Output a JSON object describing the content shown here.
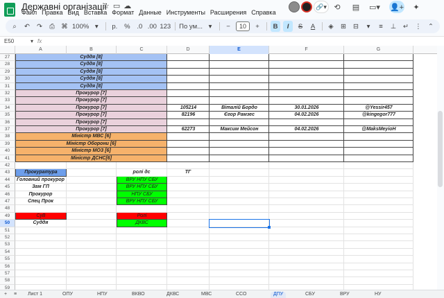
{
  "doc": {
    "title": "Державні організації",
    "menu": [
      "Файл",
      "Правка",
      "Вид",
      "Вставка",
      "Формат",
      "Данные",
      "Инструменты",
      "Расширения",
      "Справка"
    ]
  },
  "toolbar": {
    "zoom": "100%",
    "currency": "р.",
    "percent": "%",
    "dec_less": ".0",
    "dec_more": ".00",
    "number_format": "123",
    "font": "По ум...",
    "font_size": "10",
    "bold": "B",
    "italic": "I",
    "text_color": "A"
  },
  "formula": {
    "cell_ref": "E50",
    "fx": "fx",
    "value": ""
  },
  "columns": [
    "A",
    "B",
    "C",
    "D",
    "E",
    "F",
    "G"
  ],
  "rows": [
    "27",
    "28",
    "29",
    "30",
    "31",
    "32",
    "33",
    "34",
    "35",
    "36",
    "37",
    "38",
    "39",
    "40",
    "41",
    "42",
    "43",
    "44",
    "45",
    "46",
    "47",
    "48",
    "49",
    "50",
    "51",
    "52",
    "53",
    "54",
    "55",
    "56",
    "57",
    "58",
    "59",
    "60"
  ],
  "merged_rows": [
    {
      "label": "Суддя [8]",
      "color": "#a4c2f4"
    },
    {
      "label": "Суддя [8]",
      "color": "#a4c2f4"
    },
    {
      "label": "Суддя [8]",
      "color": "#a4c2f4"
    },
    {
      "label": "Суддя [8]",
      "color": "#a4c2f4"
    },
    {
      "label": "Суддя [8]",
      "color": "#a4c2f4"
    },
    {
      "label": "Прокурор [7]",
      "color": "#ead1dc"
    },
    {
      "label": "Прокурор [7]",
      "color": "#ead1dc"
    },
    {
      "label": "Прокурор [7]",
      "color": "#ead1dc"
    },
    {
      "label": "Прокурор [7]",
      "color": "#ead1dc"
    },
    {
      "label": "Прокурор [7]",
      "color": "#ead1dc"
    },
    {
      "label": "Прокурор [7]",
      "color": "#ead1dc"
    },
    {
      "label": "Міністр МВС [6]",
      "color": "#f6b26b"
    },
    {
      "label": "Міністр Оборони [6]",
      "color": "#f6b26b"
    },
    {
      "label": "Міністр МОЗ [6]",
      "color": "#f6b26b"
    },
    {
      "label": "Міністр ДСНС[6]",
      "color": "#f6b26b"
    }
  ],
  "detail_rows": [
    {
      "row_index": 7,
      "id": "105214",
      "name": "Віталій Бордо",
      "date": "30.01.2026",
      "tg": "@Yessir457"
    },
    {
      "row_index": 8,
      "id": "82196",
      "name": "Єгор Рамзес",
      "date": "04.02.2026",
      "tg": "@kingegor777"
    },
    {
      "row_index": 10,
      "id": "62273",
      "name": "Максим Мейсон",
      "date": "04.02.2026",
      "tg": "@MaksMeyioH"
    }
  ],
  "lower": {
    "header_a": "Прокуратура",
    "header_c": "ролі дс",
    "header_d": "ТГ",
    "roles": [
      {
        "name": "Головний прокурор",
        "value": "ВРУ НПУ СБУ"
      },
      {
        "name": "Зам ГП",
        "value": "ВРУ НПУ СБУ"
      },
      {
        "name": "Прокурор",
        "value": "НПУ СБУ"
      },
      {
        "name": "Спец Прок",
        "value": "ВРУ НПУ СБУ"
      }
    ],
    "court_label": "СуВ",
    "court_value": "Ролі",
    "judge_label": "Суддя",
    "judge_value": "ДКВС"
  },
  "sheets": [
    "Лист 1",
    "ОПУ",
    "НПУ",
    "ВКВО",
    "ДКВС",
    "МВС",
    "ССО",
    "ДПУ",
    "СБУ",
    "ВРУ",
    "НУ"
  ],
  "colors": {
    "blue_header": "#6d9eeb",
    "green": "#00ff00",
    "red": "#ff0000",
    "selection": "#1a73e8"
  }
}
